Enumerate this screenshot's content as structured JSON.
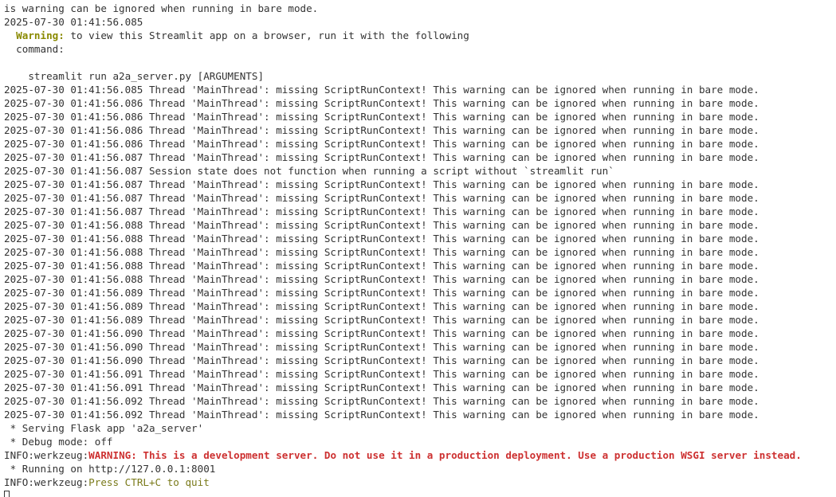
{
  "header_lines": [
    "is warning can be ignored when running in bare mode.",
    "2025-07-30 01:41:56.085"
  ],
  "warning_block": {
    "label": "Warning:",
    "text": " to view this Streamlit app on a browser, run it with the following",
    "continuation": "  command:",
    "command": "    streamlit run a2a_server.py [ARGUMENTS]"
  },
  "log_lines_a": [
    "2025-07-30 01:41:56.085 Thread 'MainThread': missing ScriptRunContext! This warning can be ignored when running in bare mode.",
    "2025-07-30 01:41:56.086 Thread 'MainThread': missing ScriptRunContext! This warning can be ignored when running in bare mode.",
    "2025-07-30 01:41:56.086 Thread 'MainThread': missing ScriptRunContext! This warning can be ignored when running in bare mode.",
    "2025-07-30 01:41:56.086 Thread 'MainThread': missing ScriptRunContext! This warning can be ignored when running in bare mode.",
    "2025-07-30 01:41:56.086 Thread 'MainThread': missing ScriptRunContext! This warning can be ignored when running in bare mode.",
    "2025-07-30 01:41:56.087 Thread 'MainThread': missing ScriptRunContext! This warning can be ignored when running in bare mode."
  ],
  "session_line": "2025-07-30 01:41:56.087 Session state does not function when running a script without `streamlit run`",
  "log_lines_b": [
    "2025-07-30 01:41:56.087 Thread 'MainThread': missing ScriptRunContext! This warning can be ignored when running in bare mode.",
    "2025-07-30 01:41:56.087 Thread 'MainThread': missing ScriptRunContext! This warning can be ignored when running in bare mode.",
    "2025-07-30 01:41:56.087 Thread 'MainThread': missing ScriptRunContext! This warning can be ignored when running in bare mode.",
    "2025-07-30 01:41:56.088 Thread 'MainThread': missing ScriptRunContext! This warning can be ignored when running in bare mode.",
    "2025-07-30 01:41:56.088 Thread 'MainThread': missing ScriptRunContext! This warning can be ignored when running in bare mode.",
    "2025-07-30 01:41:56.088 Thread 'MainThread': missing ScriptRunContext! This warning can be ignored when running in bare mode.",
    "2025-07-30 01:41:56.088 Thread 'MainThread': missing ScriptRunContext! This warning can be ignored when running in bare mode.",
    "2025-07-30 01:41:56.088 Thread 'MainThread': missing ScriptRunContext! This warning can be ignored when running in bare mode.",
    "2025-07-30 01:41:56.089 Thread 'MainThread': missing ScriptRunContext! This warning can be ignored when running in bare mode.",
    "2025-07-30 01:41:56.089 Thread 'MainThread': missing ScriptRunContext! This warning can be ignored when running in bare mode.",
    "2025-07-30 01:41:56.089 Thread 'MainThread': missing ScriptRunContext! This warning can be ignored when running in bare mode.",
    "2025-07-30 01:41:56.090 Thread 'MainThread': missing ScriptRunContext! This warning can be ignored when running in bare mode.",
    "2025-07-30 01:41:56.090 Thread 'MainThread': missing ScriptRunContext! This warning can be ignored when running in bare mode.",
    "2025-07-30 01:41:56.090 Thread 'MainThread': missing ScriptRunContext! This warning can be ignored when running in bare mode.",
    "2025-07-30 01:41:56.091 Thread 'MainThread': missing ScriptRunContext! This warning can be ignored when running in bare mode.",
    "2025-07-30 01:41:56.091 Thread 'MainThread': missing ScriptRunContext! This warning can be ignored when running in bare mode.",
    "2025-07-30 01:41:56.092 Thread 'MainThread': missing ScriptRunContext! This warning can be ignored when running in bare mode.",
    "2025-07-30 01:41:56.092 Thread 'MainThread': missing ScriptRunContext! This warning can be ignored when running in bare mode."
  ],
  "flask": {
    "serving": " * Serving Flask app 'a2a_server'",
    "debug": " * Debug mode: off",
    "info_prefix_1": "INFO:werkzeug:",
    "dev_warning": "WARNING: This is a development server. Do not use it in a production deployment. Use a production WSGI server instead.",
    "running": " * Running on http://127.0.0.1:8001",
    "info_prefix_2": "INFO:werkzeug:",
    "quit_hint": "Press CTRL+C to quit"
  },
  "colors": {
    "background": "#ffffff",
    "text": "#333333",
    "warning_label": "#8a8a00",
    "error_red": "#cd3131",
    "info_green": "#7a7a1a"
  }
}
